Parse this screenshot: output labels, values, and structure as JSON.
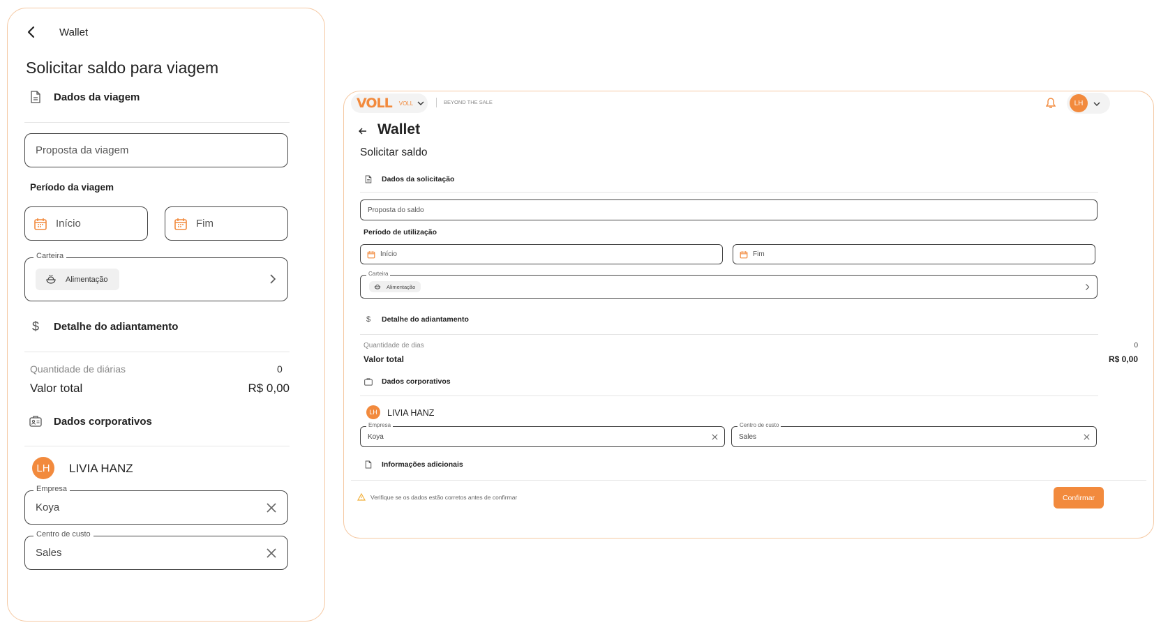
{
  "colors": {
    "accent": "#f28a3d",
    "border_accent": "#f5c9a3"
  },
  "mobile": {
    "app_name": "Wallet",
    "title": "Solicitar saldo para viagem",
    "section_trip": "Dados da viagem",
    "proposal_placeholder": "Proposta da viagem",
    "period_label": "Período da viagem",
    "start_placeholder": "Início",
    "end_placeholder": "Fim",
    "wallet_legend": "Carteira",
    "wallet_chip": "Alimentação",
    "section_advance": "Detalhe do adiantamento",
    "qty_label": "Quantidade de diárias",
    "qty_value": "0",
    "total_label": "Valor total",
    "total_value": "R$ 0,00",
    "section_corporate": "Dados corporativos",
    "avatar_initials": "LH",
    "user_name": "LIVIA HANZ",
    "company_legend": "Empresa",
    "company_value": "Koya",
    "cost_center_legend": "Centro de custo",
    "cost_center_value": "Sales"
  },
  "desktop": {
    "brand_logo": "VOLL",
    "brand_select": "VOLL",
    "tagline": "BEYOND THE SALE",
    "avatar_initials": "LH",
    "page_title": "Wallet",
    "subtitle": "Solicitar saldo",
    "section_request": "Dados da solicitação",
    "proposal_placeholder": "Proposta do saldo",
    "period_label": "Período de utilização",
    "start_placeholder": "Início",
    "end_placeholder": "Fim",
    "wallet_legend": "Carteira",
    "wallet_chip": "Alimentação",
    "section_advance": "Detalhe do adiantamento",
    "qty_label": "Quantidade de dias",
    "qty_value": "0",
    "total_label": "Valor total",
    "total_value": "R$ 0,00",
    "section_corporate": "Dados corporativos",
    "user_name": "LIVIA HANZ",
    "company_legend": "Empresa",
    "company_value": "Koya",
    "cost_center_legend": "Centro de custo",
    "cost_center_value": "Sales",
    "section_additional": "Informações adicionais",
    "footer_warning": "Verifique se os dados estão corretos antes de confirmar",
    "confirm_label": "Confirmar"
  }
}
